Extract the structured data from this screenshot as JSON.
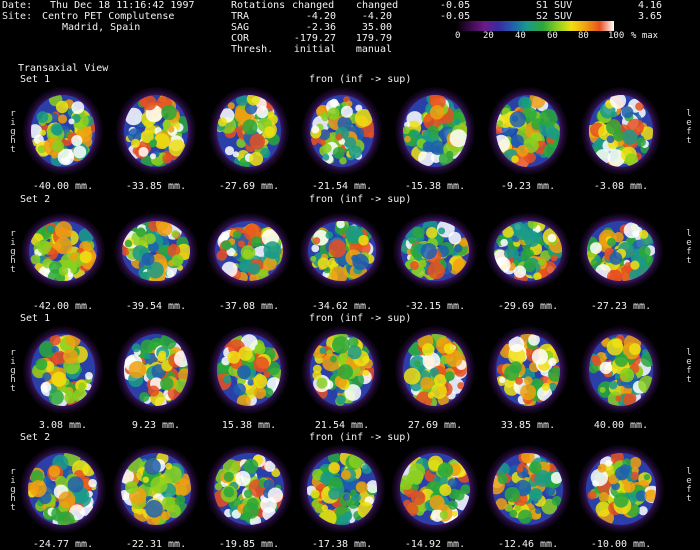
{
  "header": {
    "date_label": "Date:",
    "date_value": "Thu Dec 18 11:16:42 1997",
    "site_label": "Site:",
    "site_value": "Centro PET Complutense",
    "site_line2": "Madrid, Spain"
  },
  "rotations": {
    "col_label": "Rotations",
    "col1": "changed",
    "col2": "changed",
    "rows": [
      {
        "name": "TRA",
        "v1": "-4.20",
        "v2": "-4.20"
      },
      {
        "name": "SAG",
        "v1": "-2.36",
        "v2": "35.00"
      },
      {
        "name": "COR",
        "v1": "-179.27",
        "v2": "179.79"
      },
      {
        "name": "Thresh.",
        "v1": "initial",
        "v2": "manual"
      }
    ]
  },
  "suv": {
    "s1_min": "-0.05",
    "s1_label": "S1 SUV",
    "s1_max": "4.16",
    "s2_min": "-0.05",
    "s2_label": "S2 SUV",
    "s2_max": "3.65",
    "ticks": [
      "0",
      "20",
      "40",
      "60",
      "80",
      "100"
    ],
    "unit": "% max",
    "colormap": [
      "#000000",
      "#3a0a4a",
      "#6a1a8a",
      "#3b2aa0",
      "#1f5fb0",
      "#1a9a8a",
      "#2aa83a",
      "#8ad020",
      "#f0e010",
      "#f0a010",
      "#e85020",
      "#ffffff"
    ]
  },
  "view_title": "Transaxial View",
  "side_labels": {
    "left_side": "right",
    "right_side": "left"
  },
  "direction": "fron (inf -> sup)",
  "rows": [
    {
      "set": "Set 1",
      "captions": [
        "-40.00 mm.",
        "-33.85 mm.",
        "-27.69 mm.",
        "-21.54 mm.",
        "-15.38 mm.",
        "-9.23 mm.",
        "-3.08 mm."
      ]
    },
    {
      "set": "Set 2",
      "captions": [
        "-42.00 mm.",
        "-39.54 mm.",
        "-37.08 mm.",
        "-34.62 mm.",
        "-32.15 mm.",
        "-29.69 mm.",
        "-27.23 mm."
      ]
    },
    {
      "set": "Set 1",
      "captions": [
        "3.08 mm.",
        "9.23 mm.",
        "15.38 mm.",
        "21.54 mm.",
        "27.69 mm.",
        "33.85 mm.",
        "40.00 mm."
      ]
    },
    {
      "set": "Set 2",
      "captions": [
        "-24.77 mm.",
        "-22.31 mm.",
        "-19.85 mm.",
        "-17.38 mm.",
        "-14.92 mm.",
        "-12.46 mm.",
        "-10.00 mm."
      ]
    }
  ]
}
